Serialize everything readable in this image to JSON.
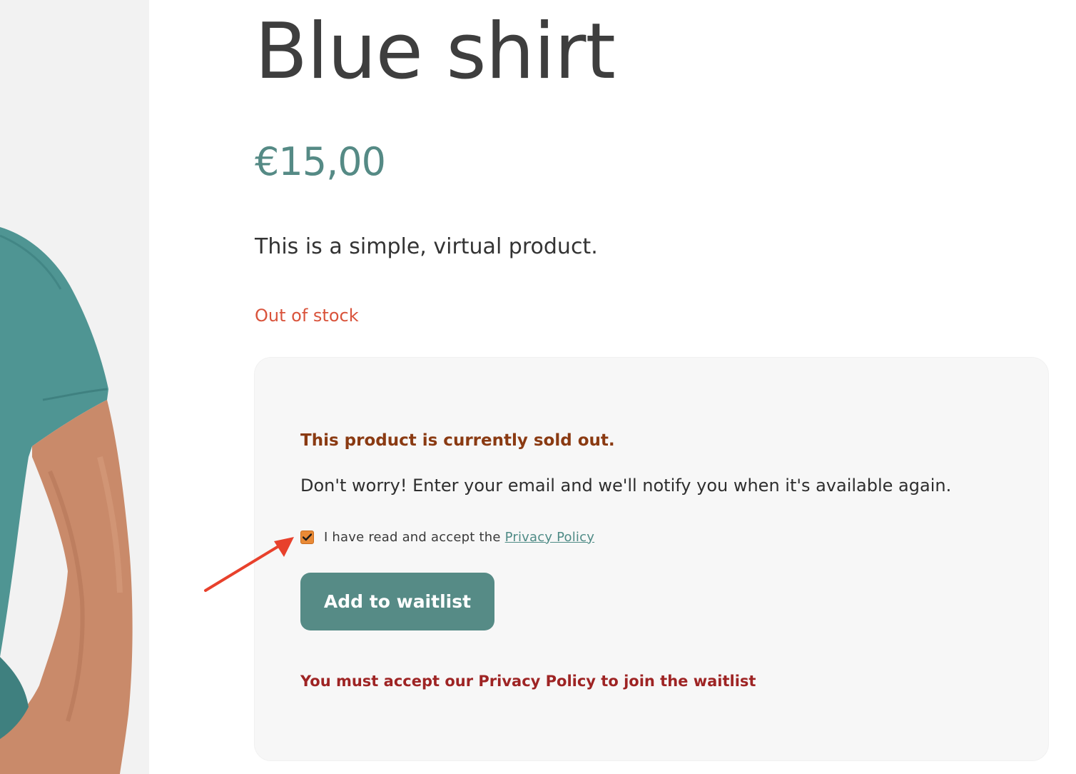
{
  "product": {
    "title": "Blue shirt",
    "price": "€15,00",
    "description": "This is a simple, virtual product.",
    "stock_status": "Out of stock"
  },
  "waitlist": {
    "heading": "This product is currently sold out.",
    "message": "Don't worry! Enter your email and we'll notify you when it's available again.",
    "consent_label": "I have read and accept the",
    "privacy_link_label": "Privacy Policy",
    "consent_checked": true,
    "button_label": "Add to waitlist",
    "error_message": "You must accept our Privacy Policy to join the waitlist"
  },
  "colors": {
    "accent": "#568b86",
    "price": "#558a85",
    "stock_status": "#d9533b",
    "checkbox": "#e98a36",
    "heading": "#8a3a12",
    "error": "#9e2424",
    "annotation_arrow": "#e8412c"
  },
  "icons": {
    "checkbox_mark": "check-icon",
    "annotation": "arrow-icon"
  }
}
